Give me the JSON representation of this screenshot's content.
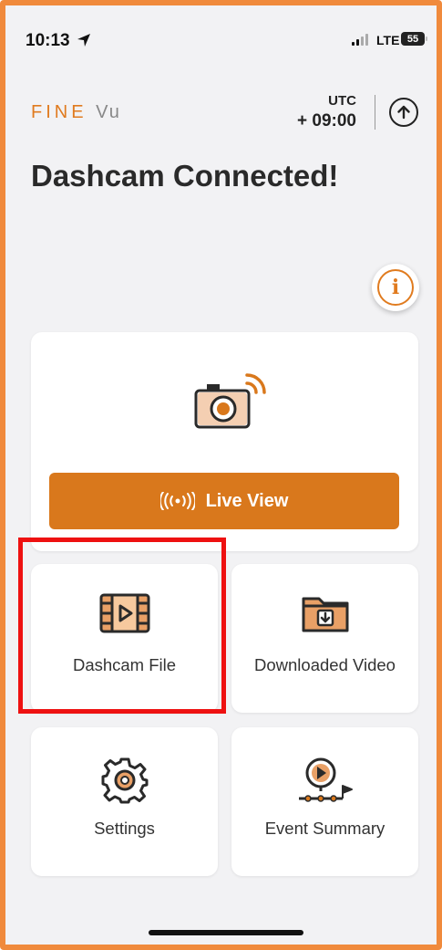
{
  "status_bar": {
    "time": "10:13",
    "network": "LTE",
    "battery": "55"
  },
  "header": {
    "logo_main": "FINE",
    "logo_suffix": "Vu",
    "utc_label": "UTC",
    "utc_offset": "+ 09:00",
    "upload_icon": "upload-arrow-icon"
  },
  "title": "Dashcam Connected!",
  "info_button": {
    "label": "i"
  },
  "live_view": {
    "button_label": "Live View",
    "icon": "camera-wifi-icon",
    "button_icon": "broadcast-icon"
  },
  "tiles": [
    {
      "label": "Dashcam File",
      "icon": "film-play-icon"
    },
    {
      "label": "Downloaded Video",
      "icon": "folder-download-icon"
    },
    {
      "label": "Settings",
      "icon": "gear-icon"
    },
    {
      "label": "Event Summary",
      "icon": "event-play-icon"
    }
  ],
  "colors": {
    "accent": "#d9781c",
    "frame": "#f08a3c",
    "highlight": "#ee1111",
    "background": "#f2f2f4"
  }
}
